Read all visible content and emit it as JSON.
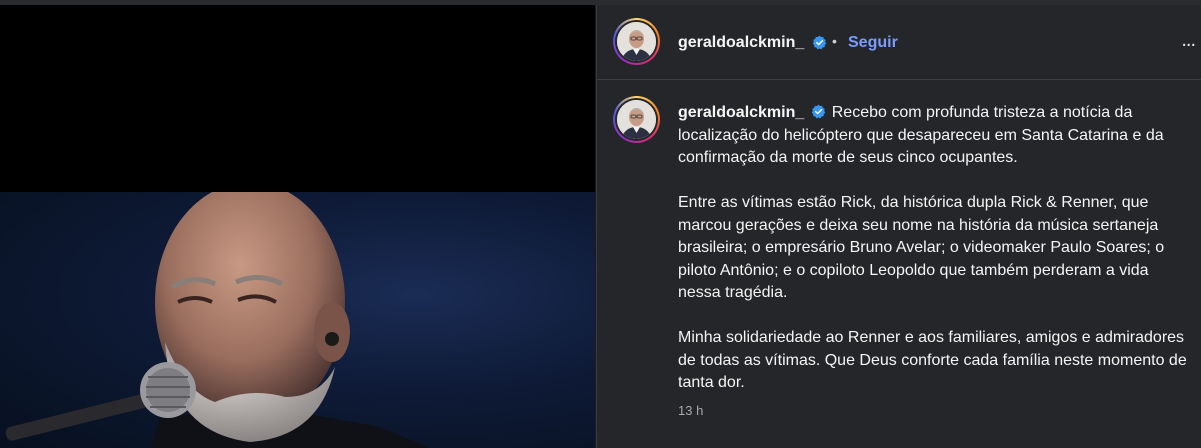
{
  "post": {
    "username": "geraldoalckmin_",
    "follow_label": "Seguir",
    "separator": "•",
    "more_label": "...",
    "caption_paragraphs": [
      "Recebo com profunda tristeza a notícia da localização do helicóptero que desapareceu em Santa Catarina e da confirmação da morte de seus cinco ocupantes.",
      "Entre as vítimas estão Rick, da histórica dupla Rick & Renner, que marcou gerações e deixa seu nome na história da música sertaneja brasileira; o empresário Bruno Avelar; o videomaker Paulo Soares; o piloto Antônio; e o copiloto Leopoldo que também perderam a vida nessa tragédia.",
      "Minha solidariedade ao Renner e aos familiares, amigos e admiradores de todas as vítimas. Que Deus conforte cada família neste momento de tanta dor."
    ],
    "timestamp": "13 h"
  },
  "colors": {
    "accent": "#7b9cff",
    "verified": "#3897f0",
    "panel_bg": "#252629"
  },
  "icons": {
    "verified": "verified-badge-icon",
    "more": "more-options-icon"
  }
}
